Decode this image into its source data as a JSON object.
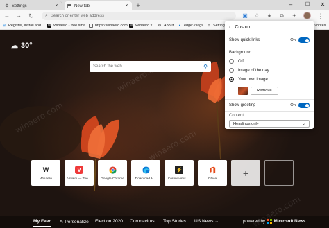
{
  "browser": {
    "tabs": [
      {
        "label": "Settings",
        "icon": "gear-icon",
        "active": false
      },
      {
        "label": "New tab",
        "icon": "newtab-icon",
        "active": true
      }
    ],
    "new_tab_symbol": "+",
    "window_controls": {
      "minimize": "–",
      "maximize": "☐",
      "close": "✕"
    },
    "address_bar": {
      "placeholder": "Search or enter web address"
    },
    "favorites": [
      {
        "label": "Register, install and...",
        "icon": "windows-icon"
      },
      {
        "label": "Winaero - free sma...",
        "icon": "winaero-icon"
      },
      {
        "label": "https://winaero.com/",
        "icon": "page-icon"
      },
      {
        "label": "Winaero x",
        "icon": "winaero-icon"
      },
      {
        "label": "About",
        "icon": "gear-icon"
      },
      {
        "label": "edge://flags",
        "icon": "edge-icon"
      },
      {
        "label": "Settings",
        "icon": "gear-icon"
      }
    ],
    "other_favorites": "Other favorites"
  },
  "newtab": {
    "weather": {
      "temp": "30°"
    },
    "search": {
      "placeholder": "Search the web"
    },
    "watermark": "winaero.com",
    "quick_links": [
      {
        "label": "Winaero",
        "icon": "winaero-icon",
        "color": "#111111"
      },
      {
        "label": "Vivaldi — The...",
        "icon": "vivaldi-icon",
        "color": "#ef3939"
      },
      {
        "label": "Google Chrome",
        "icon": "chrome-icon",
        "color": "#4285f4"
      },
      {
        "label": "Download M...",
        "icon": "edge-icon",
        "color": "#0a7cd6"
      },
      {
        "label": "Coronavirus |...",
        "icon": "news-icon",
        "color": "#222222"
      },
      {
        "label": "Office",
        "icon": "office-icon",
        "color": "#e64a19"
      }
    ],
    "add_symbol": "+",
    "news_tabs": [
      "My Feed",
      "Personalize",
      "Election 2020",
      "Coronavirus",
      "Top Stories",
      "US News"
    ],
    "powered_by": "powered by",
    "microsoft_news": "Microsoft News"
  },
  "panel": {
    "title": "Custom",
    "show_quick_links": {
      "label": "Show quick links",
      "state": "On"
    },
    "background": {
      "label": "Background",
      "options": [
        {
          "label": "Off",
          "selected": false
        },
        {
          "label": "Image of the day",
          "selected": false
        },
        {
          "label": "Your own image",
          "selected": true
        }
      ],
      "remove_label": "Remove"
    },
    "show_greeting": {
      "label": "Show greeting",
      "state": "On"
    },
    "content": {
      "label": "Content",
      "value": "Headings only"
    }
  }
}
